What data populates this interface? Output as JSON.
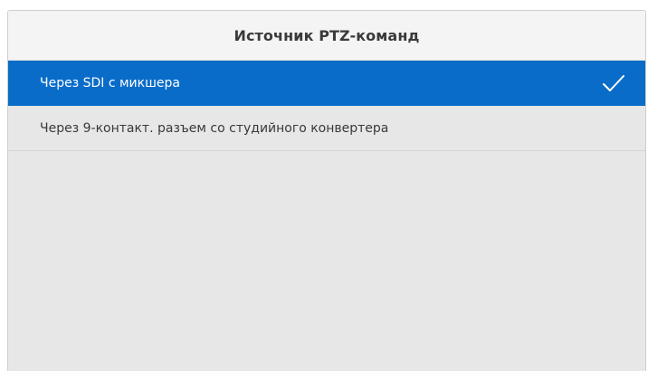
{
  "dialog": {
    "title": "Источник PTZ-команд",
    "options": [
      {
        "label": "Через SDI с микшера",
        "selected": true
      },
      {
        "label": "Через 9-контакт. разъем со студийного конвертера",
        "selected": false
      }
    ]
  },
  "colors": {
    "selected_background": "#0a6cc9",
    "panel_background": "#e7e7e7",
    "title_background": "#f4f4f4"
  },
  "icons": {
    "selected_indicator": "checkmark-icon"
  }
}
